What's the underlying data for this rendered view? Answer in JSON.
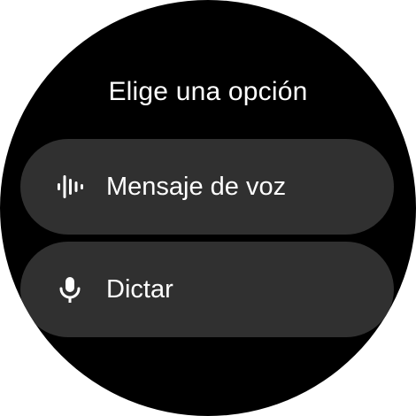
{
  "header": {
    "title": "Elige una opción"
  },
  "options": [
    {
      "label": "Mensaje de voz",
      "icon": "waveform-icon"
    },
    {
      "label": "Dictar",
      "icon": "microphone-icon"
    }
  ],
  "colors": {
    "background": "#000000",
    "chip": "#303030",
    "text": "#ffffff"
  }
}
